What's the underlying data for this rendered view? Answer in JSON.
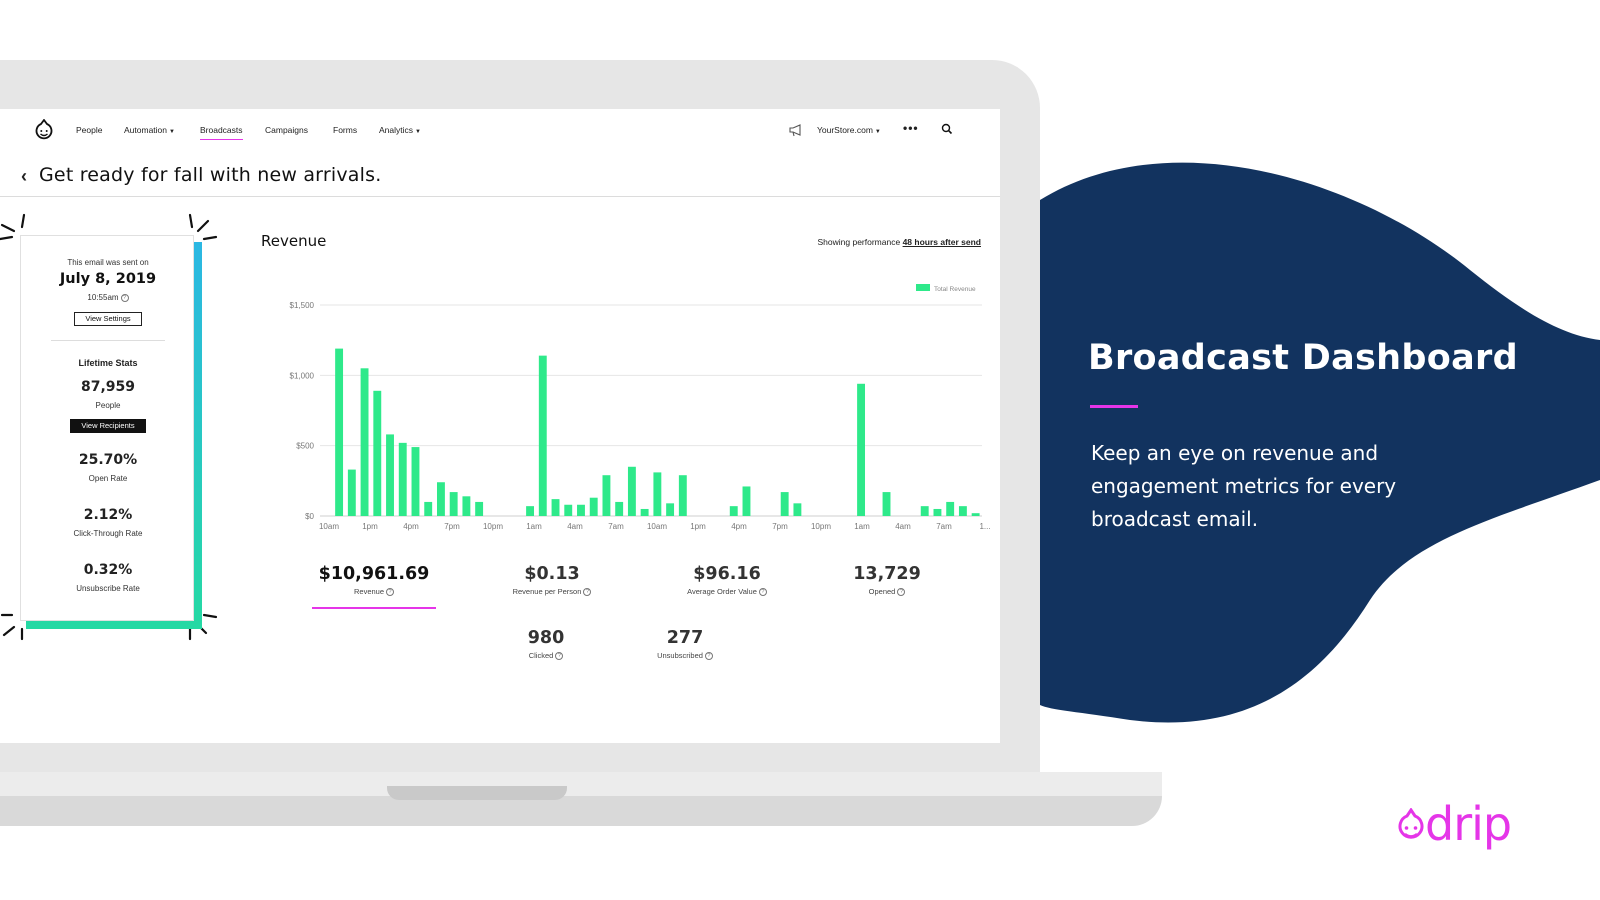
{
  "nav": {
    "items": [
      {
        "label": "People",
        "caret": false,
        "active": false
      },
      {
        "label": "Automation",
        "caret": true,
        "active": false
      },
      {
        "label": "Broadcasts",
        "caret": false,
        "active": true
      },
      {
        "label": "Campaigns",
        "caret": false,
        "active": false
      },
      {
        "label": "Forms",
        "caret": false,
        "active": false
      },
      {
        "label": "Analytics",
        "caret": true,
        "active": false
      }
    ],
    "store": "YourStore.com",
    "more_icon": "more-dots-icon",
    "search_icon": "search-icon",
    "announce_icon": "megaphone-icon"
  },
  "page": {
    "title": "Get ready for fall with new arrivals."
  },
  "card": {
    "sent_label": "This email was sent on",
    "sent_date": "July 8, 2019",
    "sent_time": "10:55am",
    "settings_button": "View Settings",
    "lifetime_title": "Lifetime Stats",
    "people_value": "87,959",
    "people_label": "People",
    "recipients_button": "View Recipients",
    "open_rate_value": "25.70%",
    "open_rate_label": "Open Rate",
    "ctr_value": "2.12%",
    "ctr_label": "Click-Through Rate",
    "unsub_rate_value": "0.32%",
    "unsub_rate_label": "Unsubscribe Rate"
  },
  "revenue": {
    "title": "Revenue",
    "note_prefix": "Showing performance",
    "note_link": "48 hours after send"
  },
  "metrics": {
    "revenue_value": "$10,961.69",
    "revenue_label": "Revenue",
    "rpp_value": "$0.13",
    "rpp_label": "Revenue per Person",
    "aov_value": "$96.16",
    "aov_label": "Average Order Value",
    "opened_value": "13,729",
    "opened_label": "Opened",
    "clicked_value": "980",
    "clicked_label": "Clicked",
    "unsubscribed_value": "277",
    "unsubscribed_label": "Unsubscribed"
  },
  "promo": {
    "title": "Broadcast Dashboard",
    "body": "Keep an eye on revenue and engagement metrics for every broadcast email."
  },
  "brand": {
    "logo_text": "drip",
    "accent": "#e535e8",
    "navy": "#12335f",
    "bar_green": "#2ee98a"
  },
  "chart_data": {
    "type": "bar",
    "title": "",
    "xlabel": "",
    "ylabel": "",
    "ylim": [
      0,
      1500
    ],
    "yticks": [
      "$0",
      "$500",
      "$1,000",
      "$1,500"
    ],
    "ytick_values": [
      0,
      500,
      1000,
      1500
    ],
    "xtick_labels": [
      "10am",
      "1pm",
      "4pm",
      "7pm",
      "10pm",
      "1am",
      "4am",
      "7am",
      "10am",
      "1pm",
      "4pm",
      "7pm",
      "10pm",
      "1am",
      "4am",
      "7am",
      "1..."
    ],
    "legend": "top-right",
    "grid": true,
    "series": [
      {
        "name": "Total Revenue",
        "color": "#2ee98a",
        "values": [
          0,
          1190,
          330,
          1050,
          890,
          580,
          520,
          490,
          100,
          240,
          170,
          140,
          100,
          0,
          0,
          0,
          70,
          1140,
          120,
          80,
          80,
          130,
          290,
          100,
          350,
          50,
          310,
          90,
          290,
          0,
          0,
          0,
          70,
          210,
          0,
          0,
          170,
          90,
          0,
          0,
          0,
          0,
          940,
          0,
          170,
          0,
          0,
          70,
          50,
          100,
          70,
          20
        ]
      }
    ]
  }
}
